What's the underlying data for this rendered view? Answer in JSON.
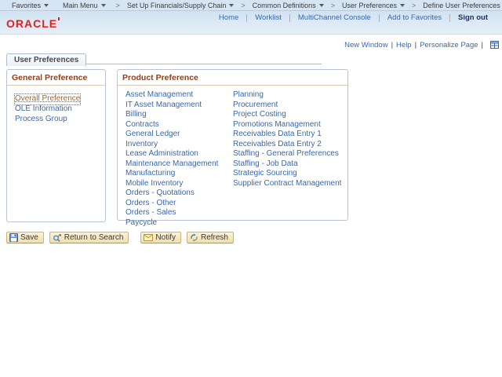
{
  "breadcrumb": {
    "items": [
      "Favorites",
      "Main Menu",
      "Set Up Financials/Supply Chain",
      "Common Definitions",
      "User Preferences",
      "Define User Preferences"
    ]
  },
  "header": {
    "logo": "ORACLE",
    "links": [
      "Home",
      "Worklist",
      "MultiChannel Console",
      "Add to Favorites",
      "Sign out"
    ]
  },
  "page_links": [
    "New Window",
    "Help",
    "Personalize Page"
  ],
  "tabs": [
    {
      "label": "User Preferences"
    }
  ],
  "panels": {
    "general": {
      "title": "General Preference",
      "selected_item": "Overall Preference",
      "items": [
        "Overall Preference",
        "OLE Information",
        "Process Group"
      ]
    },
    "product": {
      "title": "Product Preference",
      "col1": [
        "Asset Management",
        "IT Asset Management",
        "Billing",
        "Contracts",
        "General Ledger",
        "Inventory",
        "Lease Administration",
        "Maintenance Management",
        "Manufacturing",
        "Mobile Inventory",
        "Orders - Quotations",
        "Orders - Other",
        "Orders - Sales",
        "Paycycle"
      ],
      "col2": [
        "Planning",
        "Procurement",
        "Project Costing",
        "Promotions Management",
        "Receivables Data Entry 1",
        "Receivables Data Entry 2",
        "Staffing - General Preferences",
        "Staffing - Job Data",
        "Strategic Sourcing",
        "Supplier Contract Management"
      ]
    }
  },
  "toolbar": {
    "buttons": [
      {
        "label": "Save",
        "icon": "floppy-disk-icon"
      },
      {
        "label": "Return to Search",
        "icon": "magnifier-return-icon"
      },
      {
        "label": "Notify",
        "icon": "envelope-icon"
      },
      {
        "label": "Refresh",
        "icon": "refresh-arrows-icon"
      }
    ]
  },
  "icons": {
    "breadcrumb_separator": ">",
    "link_separator": "|",
    "dropdown_caret": "triangle-down",
    "personalize_grid": "grid-table"
  },
  "colors": {
    "brand_red": "#e0201f",
    "link_blue": "#3a67a8",
    "panel_title_brown": "#9c3a10",
    "selected_link_brown": "#996633",
    "topbar_blue": "#d7e4f2",
    "button_tan": "#f0dfa9"
  }
}
